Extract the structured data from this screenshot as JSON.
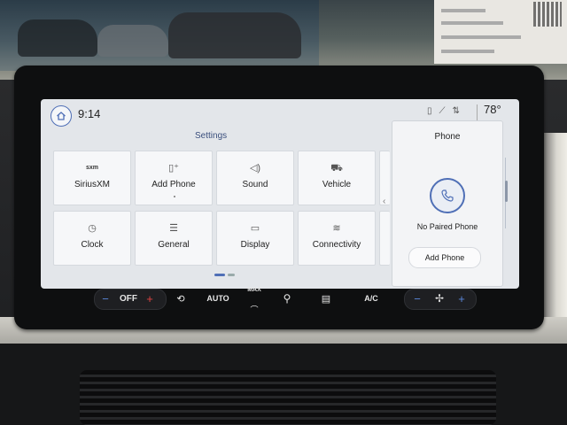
{
  "screen": {
    "time": "9:14",
    "temperature": "78°",
    "settings_title": "Settings",
    "tiles": [
      {
        "label": "SiriusXM",
        "icon": "siriusxm-logo-icon",
        "glyph": "sxm"
      },
      {
        "label": "Add Phone",
        "icon": "phone-add-icon",
        "glyph": "▯⁺"
      },
      {
        "label": "Sound",
        "icon": "speaker-icon",
        "glyph": "◁)"
      },
      {
        "label": "Vehicle",
        "icon": "vehicle-settings-icon",
        "glyph": "⛟"
      },
      {
        "label": "Clock",
        "icon": "clock-icon",
        "glyph": "◷"
      },
      {
        "label": "General",
        "icon": "sliders-icon",
        "glyph": "☰"
      },
      {
        "label": "Display",
        "icon": "display-icon",
        "glyph": "▭"
      },
      {
        "label": "Connectivity",
        "icon": "wifi-icon",
        "glyph": "≋"
      }
    ]
  },
  "phone_panel": {
    "title": "Phone",
    "status": "No Paired Phone",
    "add_label": "Add Phone"
  },
  "climate": {
    "left_minus": "−",
    "fan_off": "OFF",
    "left_plus": "+",
    "auto": "AUTO",
    "max": "MAX",
    "ac": "A/C",
    "right_minus": "−",
    "right_plus": "+"
  },
  "colors": {
    "accent": "#4f6fb6",
    "screen_bg": "#e3e6ea",
    "temp_up": "#e04343",
    "temp_down": "#5a86d8"
  }
}
